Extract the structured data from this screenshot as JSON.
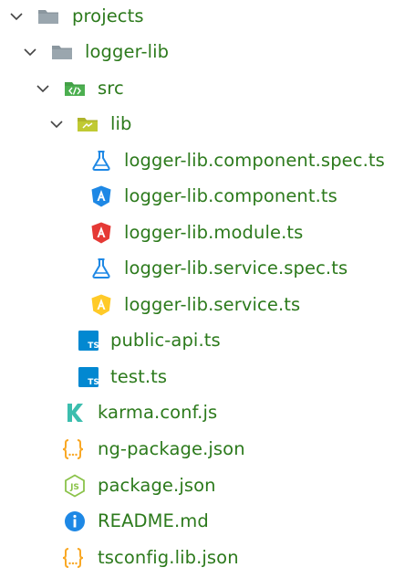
{
  "explorer": {
    "items": [
      {
        "name": "projects",
        "kind": "folder",
        "expanded": true,
        "icon": "folder-icon"
      },
      {
        "name": "logger-lib",
        "kind": "folder",
        "expanded": true,
        "icon": "folder-icon"
      },
      {
        "name": "src",
        "kind": "folder",
        "expanded": true,
        "icon": "folder-src-icon"
      },
      {
        "name": "lib",
        "kind": "folder",
        "expanded": true,
        "icon": "folder-lib-icon"
      },
      {
        "name": "logger-lib.component.spec.ts",
        "kind": "file",
        "icon": "test-flask-icon"
      },
      {
        "name": "logger-lib.component.ts",
        "kind": "file",
        "icon": "angular-component-icon"
      },
      {
        "name": "logger-lib.module.ts",
        "kind": "file",
        "icon": "angular-module-icon"
      },
      {
        "name": "logger-lib.service.spec.ts",
        "kind": "file",
        "icon": "test-flask-icon"
      },
      {
        "name": "logger-lib.service.ts",
        "kind": "file",
        "icon": "angular-service-icon"
      },
      {
        "name": "public-api.ts",
        "kind": "file",
        "icon": "typescript-icon"
      },
      {
        "name": "test.ts",
        "kind": "file",
        "icon": "typescript-icon"
      },
      {
        "name": "karma.conf.js",
        "kind": "file",
        "icon": "karma-icon"
      },
      {
        "name": "ng-package.json",
        "kind": "file",
        "icon": "json-icon"
      },
      {
        "name": "package.json",
        "kind": "file",
        "icon": "nodejs-icon"
      },
      {
        "name": "README.md",
        "kind": "file",
        "icon": "info-icon"
      },
      {
        "name": "tsconfig.lib.json",
        "kind": "file",
        "icon": "json-icon"
      }
    ]
  },
  "colors": {
    "label_text": "#2c7a1c",
    "chevron": "#444444",
    "folder": "#8b979f",
    "folder_src": "#4caf50",
    "folder_lib": "#c0ca33",
    "angular_component": "#1e88e5",
    "angular_module": "#e53935",
    "angular_service": "#ffca28",
    "test_flask": "#1e88e5",
    "typescript": "#0288d1",
    "karma": "#3cbeae",
    "json": "#f9a825",
    "nodejs": "#8bc34a",
    "info": "#1e88e5"
  }
}
